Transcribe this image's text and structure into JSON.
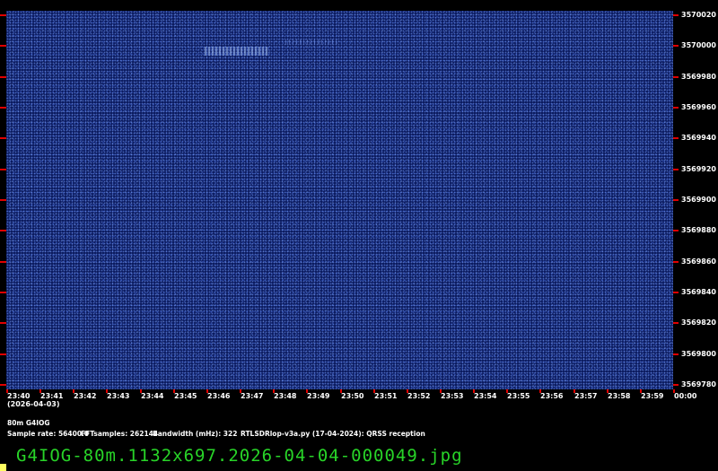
{
  "spectrogram": {
    "background_color": "#0b1a5e",
    "tick_color": "#e00000",
    "label_color": "#ffffff"
  },
  "frequency_axis": {
    "labels": [
      "3570020",
      "3570000",
      "3569980",
      "3569960",
      "3569940",
      "3569920",
      "3569900",
      "3569880",
      "3569860",
      "3569840",
      "3569820",
      "3569800",
      "3569780"
    ]
  },
  "time_axis": {
    "labels": [
      "23:40",
      "23:41",
      "23:42",
      "23:43",
      "23:44",
      "23:45",
      "23:46",
      "23:47",
      "23:48",
      "23:49",
      "23:50",
      "23:51",
      "23:52",
      "23:53",
      "23:54",
      "23:55",
      "23:56",
      "23:57",
      "23:58",
      "23:59",
      "00:00"
    ],
    "date": "(2026-04-03)"
  },
  "info": {
    "station": "80m G4IOG",
    "sample_rate": "Sample rate: 56400.0",
    "fft_samples": "FFTsamples: 262144",
    "bandwidth": "Bandwidth (mHz): 322",
    "software": "RTLSDRlop-v3a.py (17-04-2024): QRSS reception"
  },
  "filename": "G4IOG-80m.1132x697.2026-04-04-000049.jpg",
  "filename_color": "#28d428"
}
